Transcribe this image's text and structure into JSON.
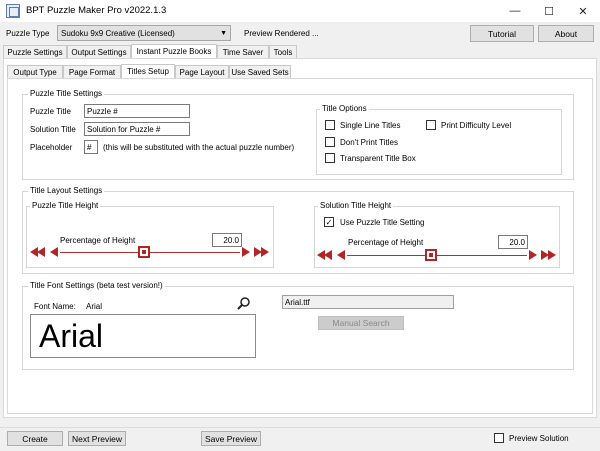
{
  "window": {
    "title": "BPT Puzzle Maker Pro v2022.1.3",
    "controls": [
      "—",
      "☐",
      "✕"
    ]
  },
  "header": {
    "puzzle_type_label": "Puzzle Type",
    "puzzle_type_value": "Sudoku 9x9 Creative (Licensed)",
    "status_text": "Preview Rendered ...",
    "tutorial_label": "Tutorial",
    "about_label": "About"
  },
  "main_tabs": [
    "Puzzle Settings",
    "Output Settings",
    "Instant Puzzle Books",
    "Time Saver",
    "Tools"
  ],
  "sub_tabs": [
    "Output Type",
    "Page Format",
    "Titles Setup",
    "Page Layout",
    "Use Saved Sets"
  ],
  "puzzle_title_settings": {
    "legend": "Puzzle Title Settings",
    "puzzle_title_label": "Puzzle Title",
    "puzzle_title_value": "Puzzle #",
    "solution_title_label": "Solution Title",
    "solution_title_value": "Solution for Puzzle #",
    "placeholder_label": "Placeholder",
    "placeholder_value": "#",
    "placeholder_note": "(this will be substituted with the actual puzzle number)"
  },
  "title_options": {
    "legend": "Title Options",
    "single_line": "Single Line Titles",
    "print_difficulty": "Print Difficulty Level",
    "dont_print": "Don't Print Titles",
    "transparent_box": "Transparent Title Box"
  },
  "title_layout": {
    "legend": "Title Layout Settings",
    "puzzle_height_legend": "Puzzle Title Height",
    "puzzle_pct_label": "Percentage of Height",
    "puzzle_pct_value": "20.0",
    "puzzle_slider_level": 0.5,
    "solution_height_legend": "Solution Title Height",
    "use_puzzle_setting": "Use Puzzle Title Setting",
    "use_puzzle_checked": "✓",
    "solution_pct_label": "Percentage of Height",
    "solution_pct_value": "20.0",
    "solution_slider_level": 0.5
  },
  "font_settings": {
    "legend": "Title Font Settings (beta test version!)",
    "font_name_label": "Font Name:",
    "font_name_value": "Arial",
    "font_file_value": "Arial.ttf",
    "manual_search_label": "Manual Search",
    "preview_text": "Arial"
  },
  "bottom": {
    "create": "Create",
    "next_preview": "Next Preview",
    "save_preview": "Save Preview",
    "preview_solution": "Preview Solution"
  },
  "colors": {
    "accent": "#b32525"
  }
}
